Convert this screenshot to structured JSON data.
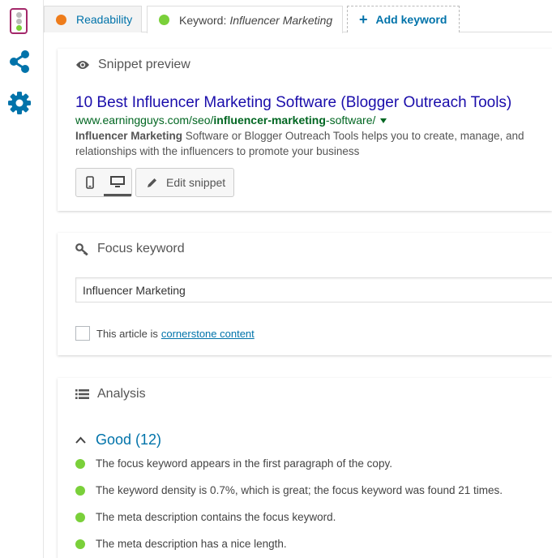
{
  "sidebar": {
    "icons": [
      "traffic-light-icon",
      "share-icon",
      "gear-icon"
    ],
    "accent": "#a4286a"
  },
  "tabs": {
    "readability": {
      "label": "Readability",
      "status_color": "#ee7c1b"
    },
    "keyword": {
      "prefix": "Keyword:",
      "value": "Influencer Marketing",
      "status_color": "#7ad03a"
    },
    "add": {
      "icon": "+",
      "label": "Add keyword"
    }
  },
  "snippet": {
    "heading": "Snippet preview",
    "title": "10 Best Influencer Marketing Software (Blogger Outreach Tools)",
    "url_base": "www.earningguys.com/seo/",
    "url_bold": "influencer-marketing",
    "url_rest": "-software/",
    "desc_bold": "Influencer Marketing",
    "desc_line1_rest": " Software or Blogger Outreach Tools helps you to create, manage, and",
    "desc_line2": "relationships with the influencers to promote your business",
    "edit_label": "Edit snippet"
  },
  "focus": {
    "heading": "Focus keyword",
    "input_value": "Influencer Marketing",
    "cornerstone_prefix": "This article is",
    "cornerstone_link": "cornerstone content"
  },
  "analysis": {
    "heading": "Analysis",
    "good_label": "Good (12)",
    "items": [
      "The focus keyword appears in the first paragraph of the copy.",
      "The keyword density is 0.7%, which is great; the focus keyword was found 21 times.",
      "The meta description contains the focus keyword.",
      "The meta description has a nice length."
    ]
  }
}
